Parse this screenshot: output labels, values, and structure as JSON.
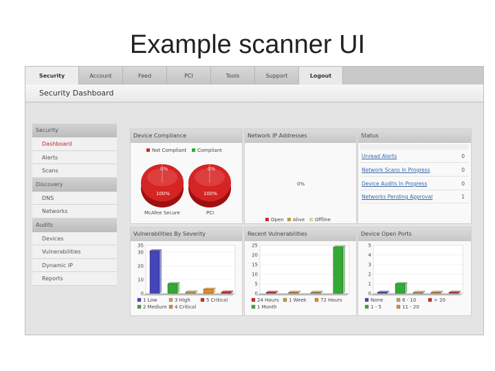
{
  "slide": {
    "title": "Example scanner UI"
  },
  "tabs": [
    {
      "label": "Security",
      "active": true
    },
    {
      "label": "Account"
    },
    {
      "label": "Feed"
    },
    {
      "label": "PCI"
    },
    {
      "label": "Tools"
    },
    {
      "label": "Support"
    },
    {
      "label": "Logout"
    }
  ],
  "header": {
    "title": "Security Dashboard"
  },
  "sidebar": {
    "sections": [
      {
        "label": "Security",
        "items": [
          "Dashboard",
          "Alerts",
          "Scans"
        ]
      },
      {
        "label": "Discovery",
        "items": [
          "DNS",
          "Networks"
        ]
      },
      {
        "label": "Audits",
        "items": [
          "Devices",
          "Vulnerabilities",
          "Dynamic IP",
          "Reports"
        ]
      }
    ],
    "active_item": "Dashboard"
  },
  "panels": {
    "device_compliance": {
      "title": "Device Compliance",
      "legend": [
        "Not Compliant",
        "Compliant"
      ],
      "pies": [
        {
          "label": "McAfee Secure",
          "top_label": "0%",
          "bottom_label": "100%"
        },
        {
          "label": "PCI",
          "top_label": "0%",
          "bottom_label": "100%"
        }
      ]
    },
    "network_ip": {
      "title": "Network IP Addresses",
      "center_label": "0%",
      "legend": [
        "Open",
        "Alive",
        "Offline"
      ]
    },
    "status": {
      "title": "Status",
      "rows": [
        {
          "label": "Unread Alerts",
          "count": "0"
        },
        {
          "label": "Network Scans In Progress",
          "count": "0"
        },
        {
          "label": "Device Audits In Progress",
          "count": "0"
        },
        {
          "label": "Networks Pending Approval",
          "count": "1"
        }
      ]
    },
    "vuln_severity": {
      "title": "Vulnerabilities By Severity"
    },
    "recent_vulns": {
      "title": "Recent Vulnerabilities"
    },
    "open_ports": {
      "title": "Device Open Ports"
    }
  },
  "colors": {
    "red": "#cc2a2a",
    "green": "#33aa33",
    "blue": "#4444bb",
    "orange": "#e08a2a",
    "tan": "#c8a060",
    "olive": "#b0a040"
  },
  "chart_data": [
    {
      "type": "bar",
      "title": "Vulnerabilities By Severity",
      "categories": [
        "1 Low",
        "2 Medium",
        "3 High",
        "4 Critical",
        "5 Critical"
      ],
      "values": [
        31,
        7,
        1,
        3,
        1
      ],
      "colors": [
        "#4444bb",
        "#33aa33",
        "#c8a060",
        "#e08a2a",
        "#cc2a2a"
      ],
      "yticks": [
        0,
        10,
        20,
        30,
        35
      ],
      "ylim": [
        0,
        35
      ],
      "legend": [
        "1 Low",
        "3 High",
        "5 Critical",
        "2 Medium",
        "4 Critical"
      ]
    },
    {
      "type": "bar",
      "title": "Recent Vulnerabilities",
      "categories": [
        "24 Hours",
        "72 Hours",
        "1 Week",
        "1 Month"
      ],
      "values": [
        0,
        0,
        0,
        24
      ],
      "colors": [
        "#cc2a2a",
        "#e08a2a",
        "#b0a040",
        "#33aa33"
      ],
      "yticks": [
        0,
        5,
        10,
        15,
        20,
        25
      ],
      "ylim": [
        0,
        25
      ],
      "legend": [
        "24 Hours",
        "1 Week",
        "72 Hours",
        "1 Month"
      ]
    },
    {
      "type": "bar",
      "title": "Device Open Ports",
      "categories": [
        "None",
        "1 - 5",
        "6 - 10",
        "11 - 20",
        "> 20"
      ],
      "values": [
        0,
        1,
        0,
        0,
        0
      ],
      "colors": [
        "#4444bb",
        "#33aa33",
        "#c8a060",
        "#e08a2a",
        "#cc2a2a"
      ],
      "yticks": [
        0,
        1,
        2,
        3,
        4,
        5
      ],
      "ylim": [
        0,
        5
      ],
      "legend": [
        "None",
        "6 - 10",
        "> 20",
        "1 - 5",
        "11 - 20"
      ]
    }
  ]
}
